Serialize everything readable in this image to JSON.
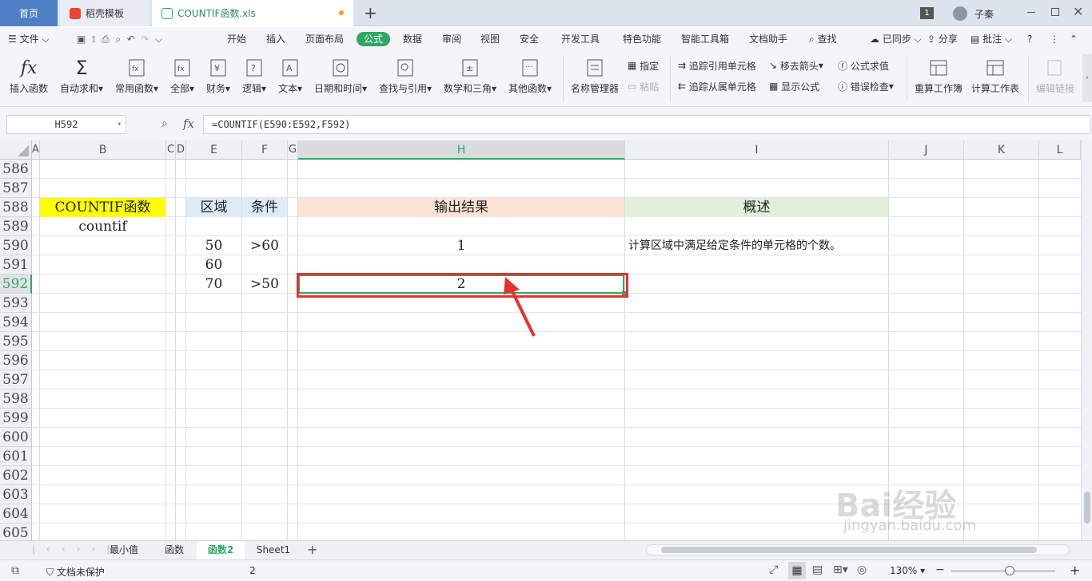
{
  "titlebar": {
    "tabs": [
      {
        "label": "首页"
      },
      {
        "label": "稻壳模板"
      },
      {
        "label": "COUNTIF函数.xls"
      }
    ],
    "new_tab": "+",
    "badge": "1",
    "user": "子秦"
  },
  "menubar": {
    "file": "文件",
    "items": [
      "开始",
      "插入",
      "页面布局",
      "公式",
      "数据",
      "审阅",
      "视图",
      "安全",
      "开发工具",
      "特色功能",
      "智能工具箱",
      "文档助手"
    ],
    "active": "公式",
    "search": "查找",
    "synced": "已同步",
    "share": "分享",
    "comment": "批注"
  },
  "ribbon": {
    "insert_fn": "插入函数",
    "autosum": "自动求和",
    "common_fn": "常用函数",
    "all": "全部",
    "finance": "财务",
    "logic": "逻辑",
    "text": "文本",
    "datetime": "日期和时间",
    "lookup": "查找与引用",
    "math": "数学和三角",
    "other_fn": "其他函数",
    "name_mgr": "名称管理器",
    "define": "指定",
    "paste": "粘贴",
    "trace_prec": "追踪引用单元格",
    "trace_dep": "追踪从属单元格",
    "remove_arrows": "移去箭头",
    "show_formula": "显示公式",
    "eval_formula": "公式求值",
    "error_check": "错误检查",
    "recalc_book": "重算工作簿",
    "calc_sheet": "计算工作表",
    "edit_links": "编辑链接"
  },
  "formula_bar": {
    "name_box": "H592",
    "fx": "fx",
    "formula": "=COUNTIF(E590:E592,F592)"
  },
  "grid": {
    "columns": [
      "A",
      "B",
      "C",
      "D",
      "E",
      "F",
      "G",
      "H",
      "I",
      "J",
      "K",
      "L"
    ],
    "rows": [
      "586",
      "587",
      "588",
      "589",
      "590",
      "591",
      "592",
      "593",
      "594",
      "595",
      "596",
      "597",
      "598",
      "599",
      "600",
      "601",
      "602",
      "603",
      "604",
      "605"
    ],
    "selected_column": "H",
    "selected_row": "592",
    "cells": {
      "B588": "COUNTIF函数",
      "B589": "countif",
      "E588": "区域",
      "F588": "条件",
      "H588": "输出结果",
      "I588": "概述",
      "E590": "50",
      "F590": ">60",
      "H590": "1",
      "I590": "计算区域中满足给定条件的单元格的个数。",
      "E591": "60",
      "E592": "70",
      "F592": ">50",
      "H592": "2"
    },
    "colors": {
      "title_fill": "#ffff00",
      "header_blue": "#ddeaf7",
      "header_orange": "#fde3d6",
      "header_green": "#e1efdb",
      "highlight_red": "#e8302f"
    }
  },
  "sheets": {
    "tabs": [
      "最小值",
      "函数",
      "函数2",
      "Sheet1"
    ],
    "active": "函数2",
    "add": "+"
  },
  "statusbar": {
    "protect": "文档未保护",
    "value": "2",
    "zoom": "130%"
  },
  "watermark": {
    "brand": "Bai经验",
    "url": "jingyan.baidu.com"
  }
}
